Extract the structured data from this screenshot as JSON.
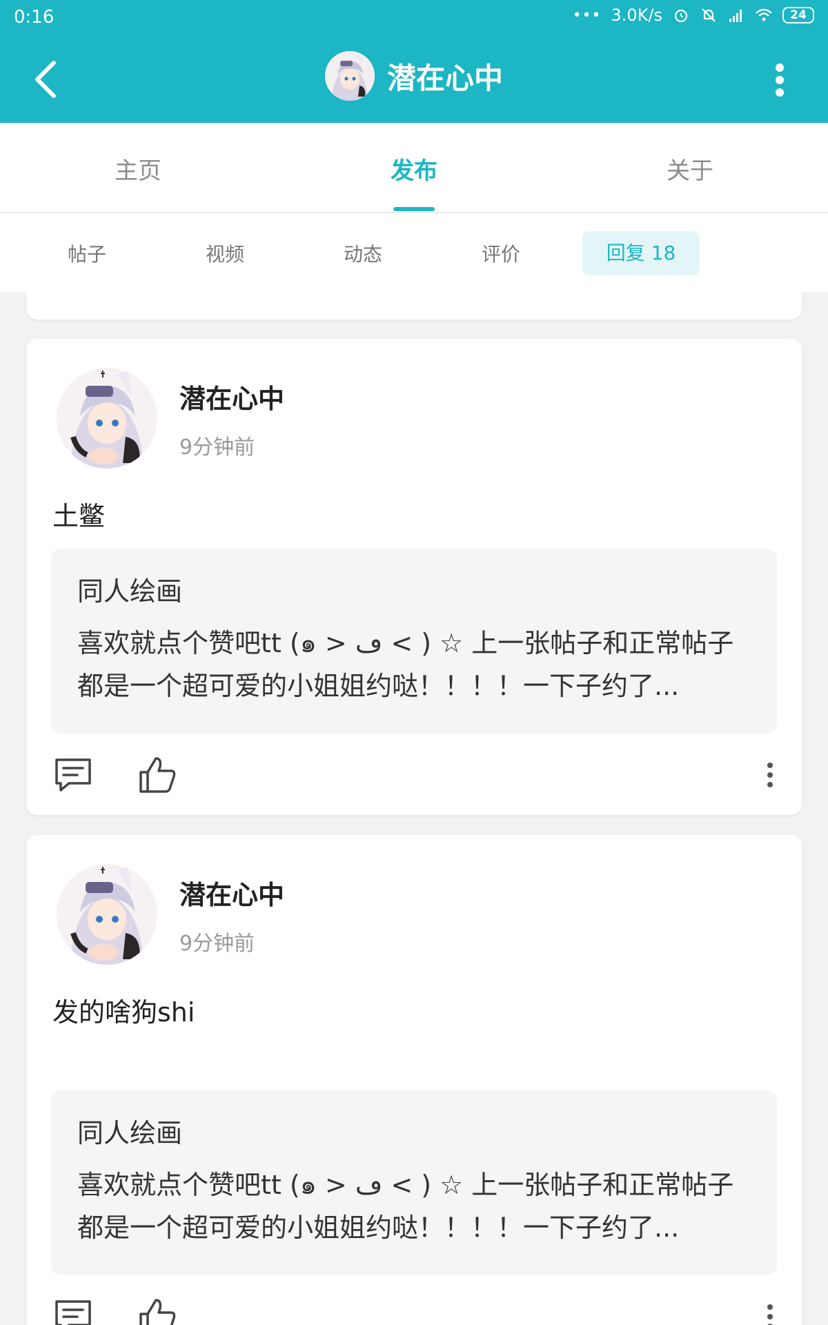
{
  "status_bar": {
    "time": "0:16",
    "network_speed": "3.0K/s",
    "battery": "24",
    "icons": [
      "dots-icon",
      "alarm-icon",
      "bell-muted-icon",
      "signal-icon",
      "wifi-icon",
      "battery-icon"
    ]
  },
  "header": {
    "title": "潜在心中",
    "back_icon": "chevron-left-icon",
    "more_icon": "more-vertical-icon"
  },
  "main_tabs": [
    {
      "label": "主页",
      "active": false
    },
    {
      "label": "发布",
      "active": true
    },
    {
      "label": "关于",
      "active": false
    }
  ],
  "sub_tabs": [
    {
      "label": "帖子",
      "active": false
    },
    {
      "label": "视频",
      "active": false
    },
    {
      "label": "动态",
      "active": false
    },
    {
      "label": "评价",
      "active": false
    },
    {
      "label": "回复 18",
      "active": true
    }
  ],
  "posts": [
    {
      "user": "潜在心中",
      "time": "9分钟前",
      "text": "土鳖",
      "quote": {
        "title": "同人绘画",
        "body": "喜欢就点个赞吧tt (๑ > ڡ < ) ☆ 上一张帖子和正常帖子都是一个超可爱的小姐姐约哒！！！！一下子约了..."
      }
    },
    {
      "user": "潜在心中",
      "time": "9分钟前",
      "text": "发的啥狗shi",
      "quote": {
        "title": "同人绘画",
        "body": "喜欢就点个赞吧tt (๑ > ڡ < ) ☆ 上一张帖子和正常帖子都是一个超可爱的小姐姐约哒！！！！一下子约了..."
      }
    }
  ],
  "colors": {
    "accent": "#1cb6c4",
    "background": "#f2f2f2",
    "card": "#ffffff",
    "quote_bg": "#f5f5f5"
  }
}
